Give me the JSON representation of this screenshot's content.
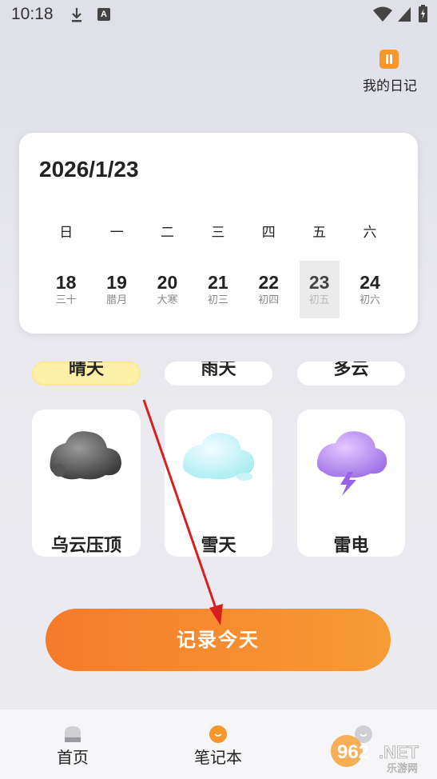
{
  "status_bar": {
    "time": "10:18"
  },
  "header": {
    "diary_label": "我的日记"
  },
  "calendar": {
    "date": "2026/1/23",
    "weekdays": [
      "日",
      "一",
      "二",
      "三",
      "四",
      "五",
      "六"
    ],
    "days": [
      {
        "num": "18",
        "lunar": "三十"
      },
      {
        "num": "19",
        "lunar": "腊月"
      },
      {
        "num": "20",
        "lunar": "大寒"
      },
      {
        "num": "21",
        "lunar": "初三"
      },
      {
        "num": "22",
        "lunar": "初四"
      },
      {
        "num": "23",
        "lunar": "初五"
      },
      {
        "num": "24",
        "lunar": "初六"
      }
    ],
    "selected_index": 5
  },
  "weather": {
    "partial_tiles": [
      "晴天",
      "雨天",
      "多云"
    ],
    "tiles": [
      "乌云压顶",
      "雪天",
      "雷电"
    ]
  },
  "actions": {
    "record_label": "记录今天"
  },
  "nav": {
    "items": [
      "首页",
      "笔记本",
      ""
    ]
  },
  "colors": {
    "accent": "#f7962b",
    "button_start": "#f57b2b",
    "button_end": "#f79c34"
  },
  "watermark": {
    "number": "962",
    "suffix": ".NET",
    "subtitle": "乐游网"
  }
}
